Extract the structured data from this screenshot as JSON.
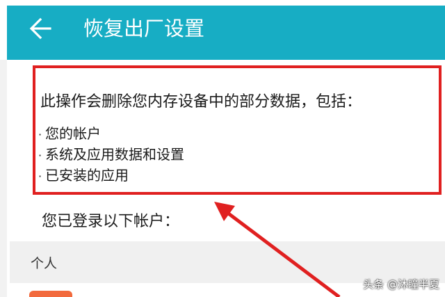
{
  "appbar": {
    "title": "恢复出厂设置",
    "color": "#17adc4"
  },
  "main": {
    "description": "此操作会删除您内存设备中的部分数据，包括：",
    "bullets": [
      "您的帐户",
      "系统及应用数据和设置",
      "已安装的应用"
    ],
    "accounts_label": "您已登录以下帐户：",
    "section_label": "个人"
  },
  "annotation": {
    "highlight_color": "#e02020"
  },
  "watermark": "头条 @沐瞳半夏",
  "icons": {
    "back": "back-arrow-icon"
  }
}
